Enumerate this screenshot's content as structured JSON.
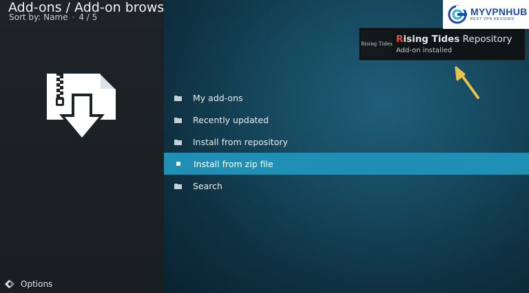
{
  "header": {
    "title": "Add-ons / Add-on browser",
    "sort_label": "Sort by: Name",
    "sort_separator": "·",
    "page_counter": "4 / 5"
  },
  "menu": {
    "items": [
      {
        "label": "My add-ons",
        "icon": "folder-icon"
      },
      {
        "label": "Recently updated",
        "icon": "folder-icon"
      },
      {
        "label": "Install from repository",
        "icon": "folder-icon"
      },
      {
        "label": "Install from zip file",
        "icon": "bullet-icon",
        "selected": true
      },
      {
        "label": "Search",
        "icon": "folder-icon"
      }
    ]
  },
  "footer": {
    "options_label": "Options"
  },
  "notification": {
    "thumb_text": "Rising Tides",
    "title_first_letter": "R",
    "title_rest_bold": "ising Tides",
    "title_rest": " Repository",
    "subtitle": "Add-on installed"
  },
  "watermark": {
    "name": "MYVPNHUB",
    "tagline": "BEST VPN REVIEWS"
  },
  "colors": {
    "selected_row": "#1f8fb5",
    "accent_red": "#e0503c",
    "annotation_arrow": "#e8c24a",
    "logo_blue": "#1c4aa3"
  }
}
